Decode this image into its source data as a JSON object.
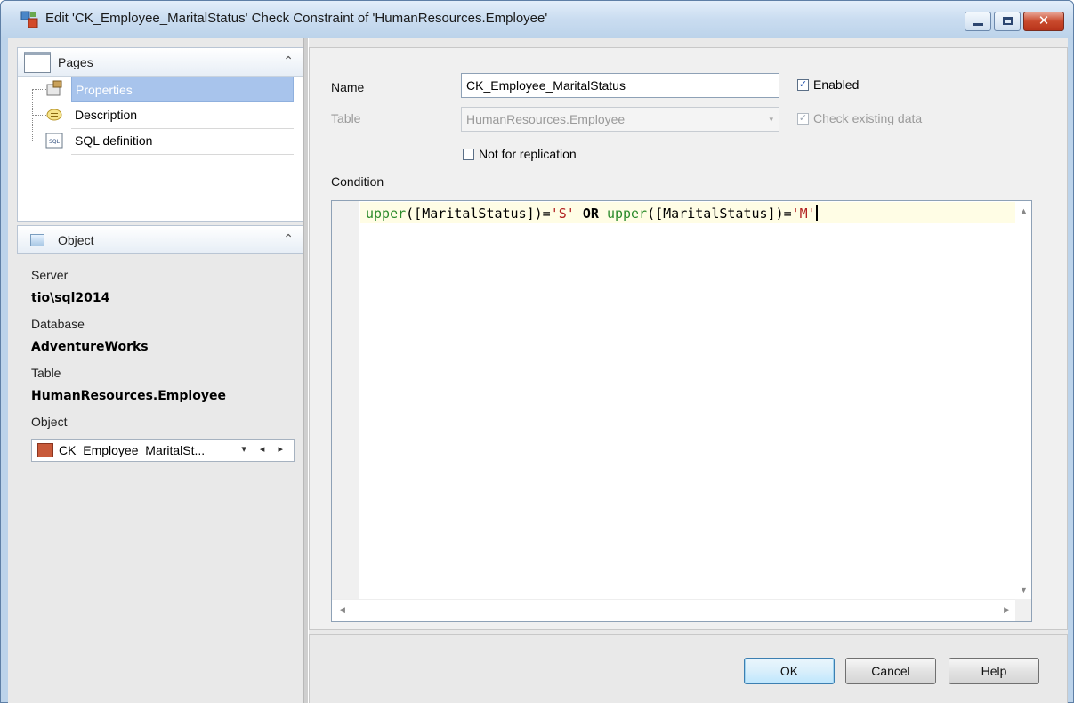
{
  "window": {
    "title": "Edit 'CK_Employee_MaritalStatus' Check Constraint of 'HumanResources.Employee'",
    "icon": "constraint-edit-icon",
    "controls": {
      "minimize": "minimize-icon",
      "maximize": "maximize-icon",
      "close_glyph": "✕"
    }
  },
  "pages_panel": {
    "title": "Pages",
    "collapse_glyph": "≈",
    "items": [
      {
        "label": "Properties",
        "icon": "properties-icon",
        "selected": true
      },
      {
        "label": "Description",
        "icon": "description-icon",
        "selected": false
      },
      {
        "label": "SQL definition",
        "icon": "sql-icon",
        "icon_text": "SQL",
        "selected": false
      }
    ]
  },
  "object_panel": {
    "title": "Object",
    "collapse_glyph": "≈",
    "server_label": "Server",
    "server_value": "tio\\sql2014",
    "database_label": "Database",
    "database_value": "AdventureWorks",
    "table_label": "Table",
    "table_value": "HumanResources.Employee",
    "object_label": "Object",
    "object_combo_value": "CK_Employee_MaritalSt...",
    "object_combo_arrows": "▾ ◂ ▸"
  },
  "form": {
    "name_label": "Name",
    "name_value": "CK_Employee_MaritalStatus",
    "enabled_label": "Enabled",
    "enabled_checked": true,
    "table_label": "Table",
    "table_value": "HumanResources.Employee",
    "table_dropdown_glyph": "▾",
    "check_existing_label": "Check existing data",
    "check_existing_checked": true,
    "not_for_replication_label": "Not for replication",
    "not_for_replication_checked": false,
    "condition_label": "Condition",
    "checkmark": "✓"
  },
  "condition_editor": {
    "tokens": [
      {
        "text": "upper",
        "type": "fn"
      },
      {
        "text": "([MaritalStatus])=",
        "type": "plain"
      },
      {
        "text": "'S'",
        "type": "str"
      },
      {
        "text": " OR ",
        "type": "kw"
      },
      {
        "text": "upper",
        "type": "fn"
      },
      {
        "text": "([MaritalStatus])=",
        "type": "plain"
      },
      {
        "text": "'M'",
        "type": "str"
      }
    ],
    "scroll_glyphs": {
      "up": "▲",
      "down": "▼",
      "left": "◀",
      "right": "▶"
    }
  },
  "buttons": {
    "ok": "OK",
    "cancel": "Cancel",
    "help": "Help"
  },
  "colors": {
    "selection": "#a8c4ec",
    "function": "#2a8a2a",
    "string": "#b22222",
    "current_line": "#fffde5"
  }
}
